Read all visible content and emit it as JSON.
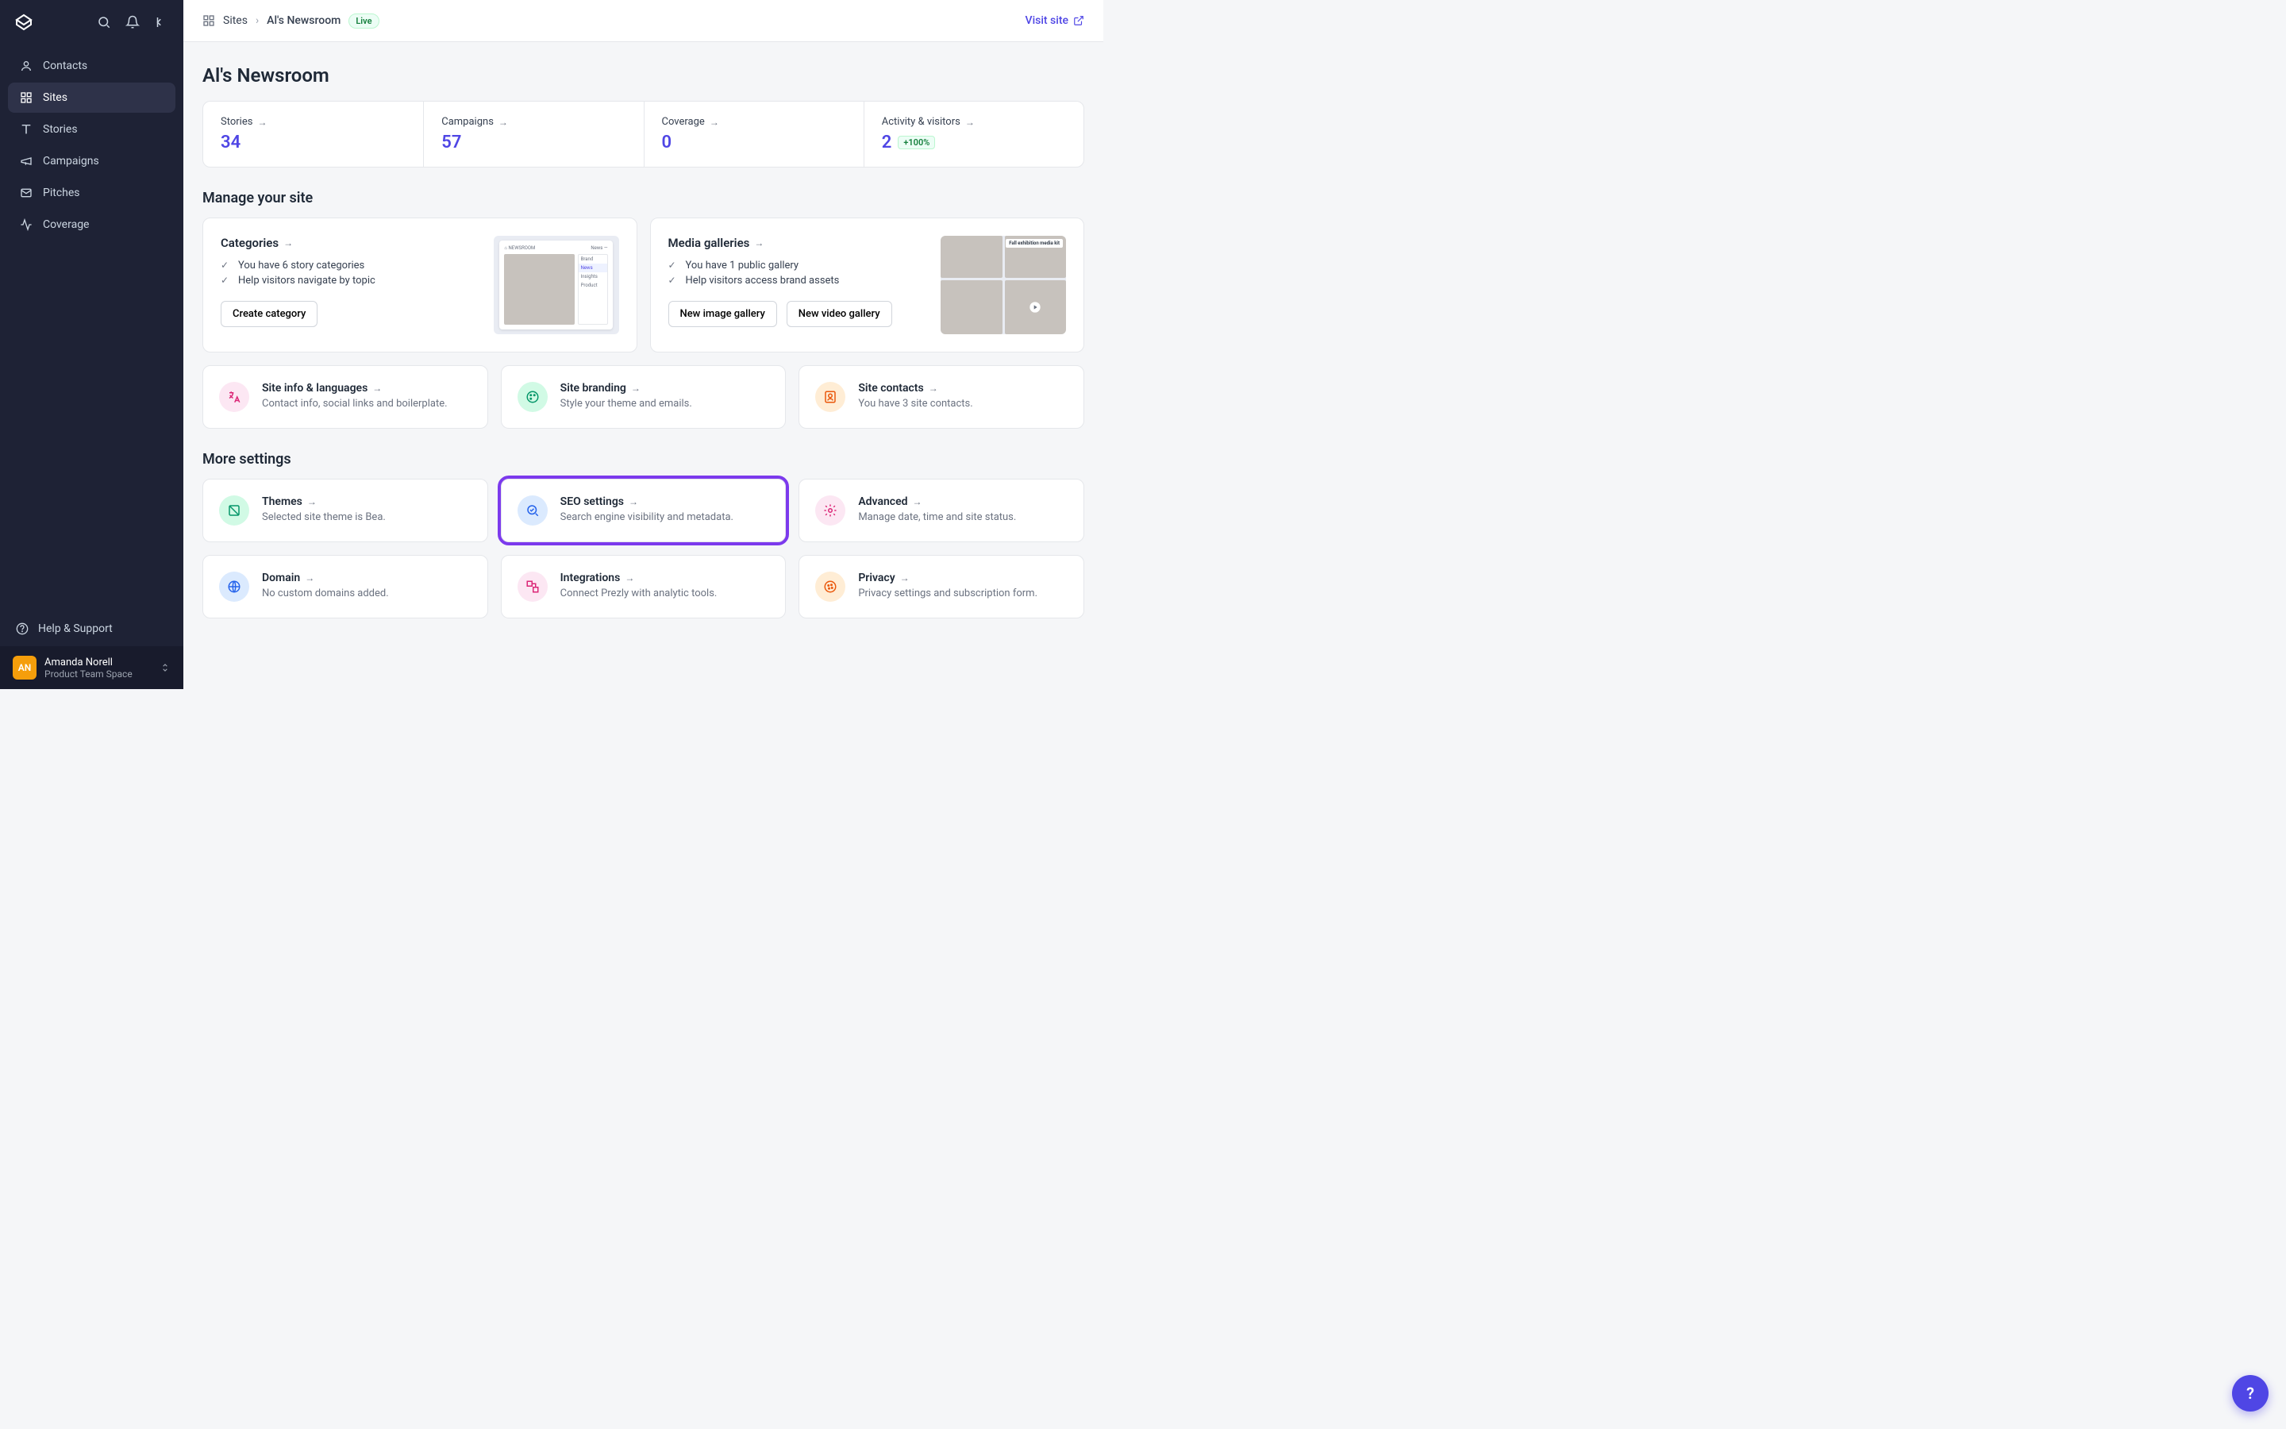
{
  "sidebar": {
    "items": [
      {
        "label": "Contacts"
      },
      {
        "label": "Sites"
      },
      {
        "label": "Stories"
      },
      {
        "label": "Campaigns"
      },
      {
        "label": "Pitches"
      },
      {
        "label": "Coverage"
      }
    ],
    "help_label": "Help & Support",
    "user": {
      "initials": "AN",
      "name": "Amanda Norell",
      "workspace": "Product Team Space"
    }
  },
  "breadcrumb": {
    "parent": "Sites",
    "current": "Al's Newsroom",
    "status": "Live"
  },
  "visit_label": "Visit site",
  "page_title": "Al's Newsroom",
  "stats": [
    {
      "label": "Stories",
      "value": "34"
    },
    {
      "label": "Campaigns",
      "value": "57"
    },
    {
      "label": "Coverage",
      "value": "0"
    },
    {
      "label": "Activity & visitors",
      "value": "2",
      "delta": "+100%"
    }
  ],
  "manage_title": "Manage your site",
  "categories_card": {
    "title": "Categories",
    "bullets": [
      "You have 6 story categories",
      "Help visitors navigate by topic"
    ],
    "button": "Create category",
    "thumb_nav_label": "NEWSROOM",
    "thumb_nav_links": [
      "News",
      "—"
    ],
    "thumb_menu": [
      "Brand",
      "News",
      "Insights",
      "Product"
    ]
  },
  "media_card": {
    "title": "Media galleries",
    "bullets": [
      "You have 1 public gallery",
      "Help visitors access brand assets"
    ],
    "button1": "New image gallery",
    "button2": "New video gallery",
    "thumb_title": "Fall exhibition media kit"
  },
  "row3": [
    {
      "title": "Site info & languages",
      "desc": "Contact info, social links and boilerplate.",
      "color": "pink",
      "icon": "translate"
    },
    {
      "title": "Site branding",
      "desc": "Style your theme and emails.",
      "color": "green",
      "icon": "palette"
    },
    {
      "title": "Site contacts",
      "desc": "You have 3 site contacts.",
      "color": "orange",
      "icon": "contact"
    }
  ],
  "more_title": "More settings",
  "settings": [
    {
      "title": "Themes",
      "desc": "Selected site theme is Bea.",
      "color": "green",
      "icon": "theme"
    },
    {
      "title": "SEO settings",
      "desc": "Search engine visibility and metadata.",
      "color": "blue",
      "icon": "seo",
      "highlight": true
    },
    {
      "title": "Advanced",
      "desc": "Manage date, time and site status.",
      "color": "pink",
      "icon": "gear"
    },
    {
      "title": "Domain",
      "desc": "No custom domains added.",
      "color": "blue",
      "icon": "globe"
    },
    {
      "title": "Integrations",
      "desc": "Connect Prezly with analytic tools.",
      "color": "pink",
      "icon": "integrations"
    },
    {
      "title": "Privacy",
      "desc": "Privacy settings and subscription form.",
      "color": "orange",
      "icon": "cookie"
    }
  ]
}
